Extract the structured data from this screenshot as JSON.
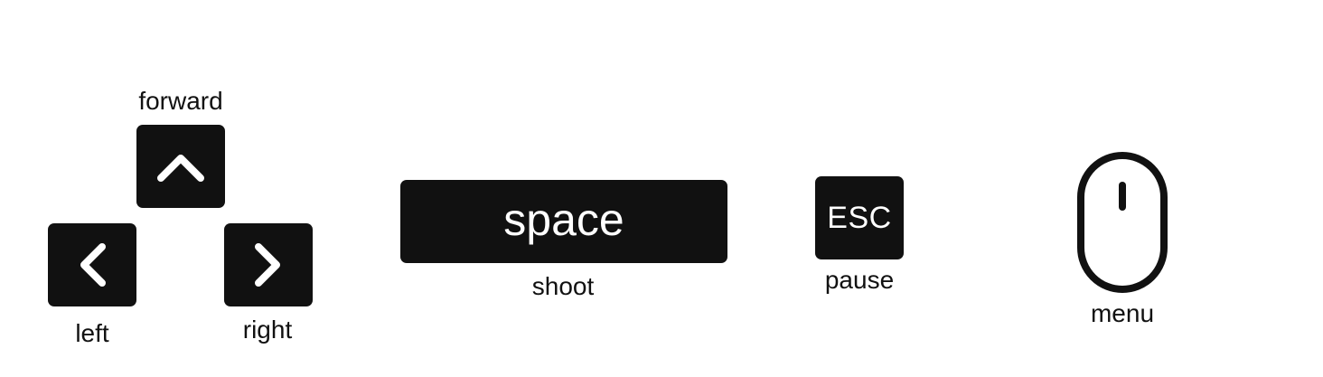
{
  "controls": {
    "forward": {
      "label": "forward",
      "key_icon": "chevron-up-icon"
    },
    "left": {
      "label": "left",
      "key_icon": "chevron-left-icon"
    },
    "right": {
      "label": "right",
      "key_icon": "chevron-right-icon"
    },
    "shoot": {
      "label": "shoot",
      "key_text": "space"
    },
    "pause": {
      "label": "pause",
      "key_text": "ESC"
    },
    "menu": {
      "label": "menu",
      "key_icon": "mouse-icon"
    }
  },
  "colors": {
    "key_background": "#111111",
    "key_foreground": "#ffffff",
    "label_text": "#111111",
    "page_background": "#ffffff"
  }
}
